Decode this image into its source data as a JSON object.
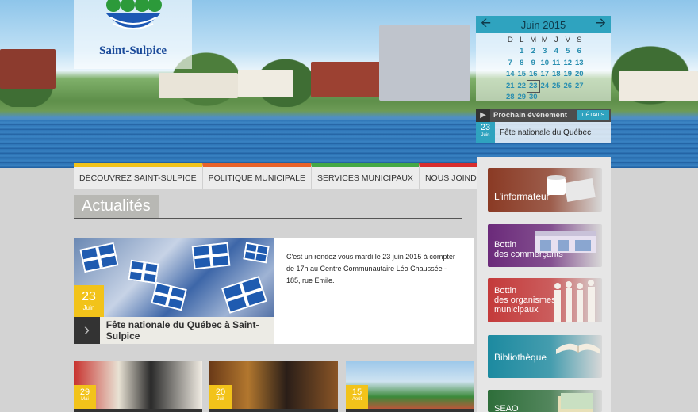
{
  "logo": {
    "text": "Saint-Sulpice"
  },
  "calendar": {
    "month_label": "Juin 2015",
    "prev_icon": "arrow-left-icon",
    "next_icon": "arrow-right-icon",
    "weekdays": [
      "D",
      "L",
      "M",
      "M",
      "J",
      "V",
      "S"
    ],
    "weeks": [
      [
        "",
        "1",
        "2",
        "3",
        "4",
        "5",
        "6"
      ],
      [
        "7",
        "8",
        "9",
        "10",
        "11",
        "12",
        "13"
      ],
      [
        "14",
        "15",
        "16",
        "17",
        "18",
        "19",
        "20"
      ],
      [
        "21",
        "22",
        "23",
        "24",
        "25",
        "26",
        "27"
      ],
      [
        "28",
        "29",
        "30",
        "",
        "",
        "",
        ""
      ]
    ],
    "selected_day": "23"
  },
  "next_event": {
    "heading": "Prochain événement",
    "details_label": "DÉTAILS",
    "day": "23",
    "month": "Juin",
    "name": "Fête nationale du Québec"
  },
  "nav": {
    "items": [
      {
        "label": "DÉCOUVREZ SAINT-SULPICE",
        "color": "#f2c31a"
      },
      {
        "label": "POLITIQUE MUNICIPALE",
        "color": "#e8632a"
      },
      {
        "label": "SERVICES MUNICIPAUX",
        "color": "#45a845"
      },
      {
        "label": "NOUS JOINDRE",
        "color": "#d82e2e"
      }
    ]
  },
  "section": {
    "title": "Actualités"
  },
  "featured": {
    "day": "23",
    "month": "Juin",
    "title": "Fête nationale du Québec à Saint-Sulpice",
    "body": "C'est un rendez vous mardi le 23 juin 2015 à compter de 17h au Centre Communautaire Léo Chaussée - 185, rue Émile."
  },
  "cards": [
    {
      "day": "29",
      "month": "Mai"
    },
    {
      "day": "20",
      "month": "Juil"
    },
    {
      "day": "15",
      "month": "Août"
    }
  ],
  "promos": [
    {
      "line1": "L'informateur",
      "line2": "",
      "color": "#8a3a24"
    },
    {
      "line1": "Bottin",
      "line2": "des commerçants",
      "color": "#6b2a7a"
    },
    {
      "line1": "Bottin",
      "line2": "des organismes municipaux",
      "color": "#c43a3a"
    },
    {
      "line1": "Bibliothèque",
      "line2": "",
      "color": "#1c8aa0"
    },
    {
      "line1": "SEAO",
      "line2": "",
      "color": "#2e6e3a"
    }
  ]
}
